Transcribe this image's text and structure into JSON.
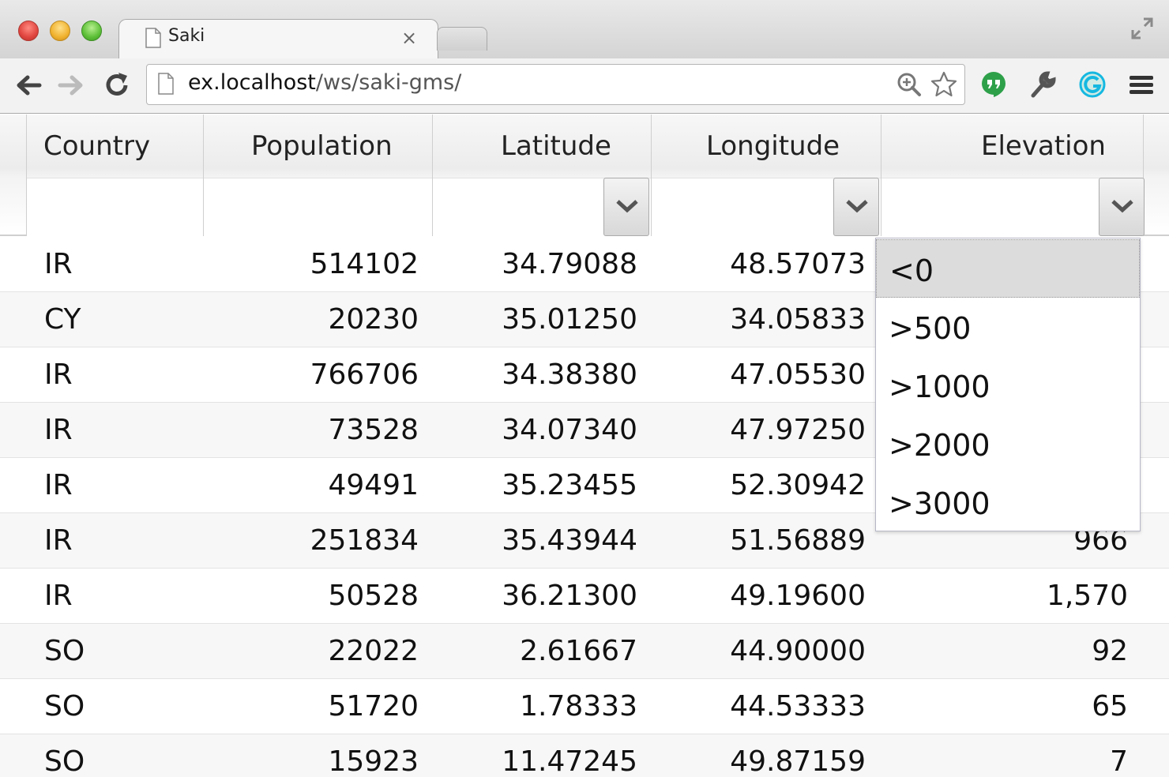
{
  "browser": {
    "tab_title": "Saki",
    "tab_close": "×",
    "url_host": "ex.localhost",
    "url_path": "/ws/saki-gms/"
  },
  "icons": [
    "back-arrow-icon",
    "forward-arrow-icon",
    "reload-icon",
    "page-icon",
    "zoom-icon",
    "star-icon",
    "hangouts-icon",
    "wrench-icon",
    "grammarly-icon",
    "menu-icon",
    "fullscreen-icon"
  ],
  "grid": {
    "columns": [
      "Country",
      "Population",
      "Latitude",
      "Longitude",
      "Elevation"
    ],
    "rows": [
      {
        "country": "IR",
        "population": "514102",
        "latitude": "34.79088",
        "longitude": "48.57073",
        "elevation": ""
      },
      {
        "country": "CY",
        "population": "20230",
        "latitude": "35.01250",
        "longitude": "34.05833",
        "elevation": ""
      },
      {
        "country": "IR",
        "population": "766706",
        "latitude": "34.38380",
        "longitude": "47.05530",
        "elevation": ""
      },
      {
        "country": "IR",
        "population": "73528",
        "latitude": "34.07340",
        "longitude": "47.97250",
        "elevation": ""
      },
      {
        "country": "IR",
        "population": "49491",
        "latitude": "35.23455",
        "longitude": "52.30942",
        "elevation": ""
      },
      {
        "country": "IR",
        "population": "251834",
        "latitude": "35.43944",
        "longitude": "51.56889",
        "elevation": "966"
      },
      {
        "country": "IR",
        "population": "50528",
        "latitude": "36.21300",
        "longitude": "49.19600",
        "elevation": "1,570"
      },
      {
        "country": "SO",
        "population": "22022",
        "latitude": "2.61667",
        "longitude": "44.90000",
        "elevation": "92"
      },
      {
        "country": "SO",
        "population": "51720",
        "latitude": "1.78333",
        "longitude": "44.53333",
        "elevation": "65"
      },
      {
        "country": "SO",
        "population": "15923",
        "latitude": "11.47245",
        "longitude": "49.87159",
        "elevation": "7"
      }
    ]
  },
  "elevation_filter": {
    "options": [
      "<0",
      ">500",
      ">1000",
      ">2000",
      ">3000"
    ],
    "highlighted": "<0"
  }
}
